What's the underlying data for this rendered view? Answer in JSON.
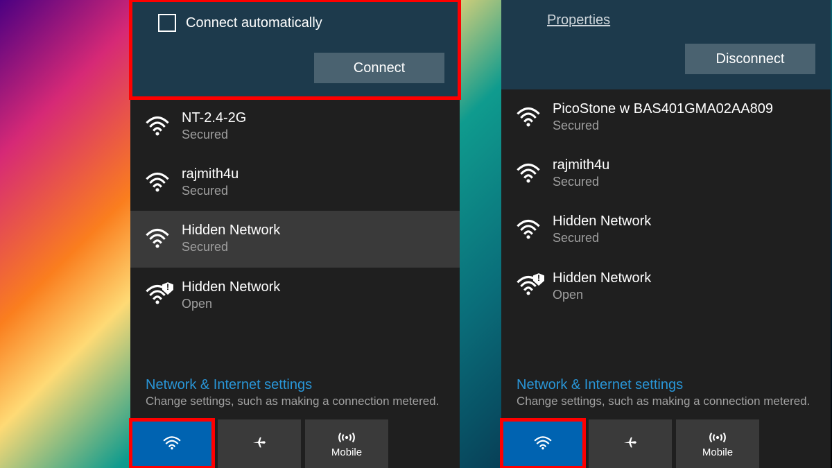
{
  "left_panel": {
    "expanded": {
      "checkbox_label": "Connect automatically",
      "button_label": "Connect"
    },
    "networks": [
      {
        "name": "NT-2.4-2G",
        "security": "Secured",
        "open_badge": false,
        "selected": false
      },
      {
        "name": "rajmith4u",
        "security": "Secured",
        "open_badge": false,
        "selected": false
      },
      {
        "name": "Hidden Network",
        "security": "Secured",
        "open_badge": false,
        "selected": true
      },
      {
        "name": "Hidden Network",
        "security": "Open",
        "open_badge": true,
        "selected": false
      }
    ],
    "settings_title": "Network & Internet settings",
    "settings_sub": "Change settings, such as making a connection metered.",
    "tiles": {
      "wifi": {
        "label": ""
      },
      "airplane": {
        "label": ""
      },
      "mobile": {
        "label": "Mobile"
      }
    }
  },
  "right_panel": {
    "expanded": {
      "properties_label": "Properties",
      "button_label": "Disconnect"
    },
    "networks": [
      {
        "name": "PicoStone w BAS401GMA02AA809",
        "security": "Secured",
        "open_badge": false,
        "selected": false
      },
      {
        "name": "rajmith4u",
        "security": "Secured",
        "open_badge": false,
        "selected": false
      },
      {
        "name": "Hidden Network",
        "security": "Secured",
        "open_badge": false,
        "selected": false
      },
      {
        "name": "Hidden Network",
        "security": "Open",
        "open_badge": true,
        "selected": false
      }
    ],
    "settings_title": "Network & Internet settings",
    "settings_sub": "Change settings, such as making a connection metered.",
    "tiles": {
      "wifi": {
        "label": ""
      },
      "airplane": {
        "label": ""
      },
      "mobile": {
        "label": "Mobile"
      }
    }
  }
}
